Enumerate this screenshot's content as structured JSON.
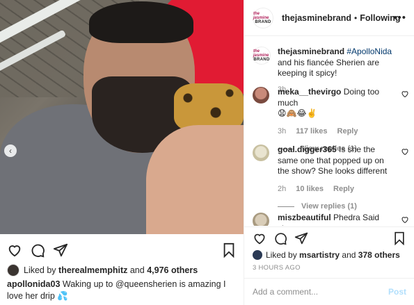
{
  "post": {
    "author": "thejasminebrand",
    "follow_state": "Following",
    "more_label": "•••",
    "logo_text_top": "the jasmine",
    "logo_text_bottom": "BRAND"
  },
  "caption_comment": {
    "author": "thejasminebrand",
    "hashtag": "#ApolloNida",
    "text": " and his fiancée Sherien are keeping it spicy!",
    "time": "3h"
  },
  "comments": [
    {
      "author": "meka__thevirgo",
      "text": "Doing too much",
      "emojis": "😧🙈😂✌️",
      "time": "3h",
      "likes": "117 likes",
      "reply": "Reply",
      "view_replies": "View replies (1)"
    },
    {
      "author": "goal.digger365",
      "text": "Is she the same one that popped up on the show? She looks different",
      "time": "2h",
      "likes": "10 likes",
      "reply": "Reply",
      "view_replies": "View replies (1)"
    },
    {
      "author": "miszbeautiful",
      "text": "Phedra Said she"
    }
  ],
  "left": {
    "liked_by_prefix": "Liked by ",
    "liked_by_user": "therealmemphitz",
    "liked_by_and": " and ",
    "liked_by_count": "4,976 others",
    "caption_author": "apollonida03",
    "caption_text": "Waking up to @queensherien is amazing I love her drip 💦",
    "carousel_prev": "‹"
  },
  "right": {
    "liked_by_prefix": "Liked by ",
    "liked_by_user": "msartistry",
    "liked_by_and": " and ",
    "liked_by_count": "378 others",
    "time_ago": "3 HOURS AGO",
    "comment_placeholder": "Add a comment...",
    "post_label": "Post"
  },
  "colors": {
    "text": "#262626",
    "muted": "#8e8e8e",
    "link": "#00376b",
    "post_disabled": "#b2dffc",
    "border": "#efefef"
  },
  "icons": [
    "heart-icon",
    "comment-icon",
    "share-icon",
    "bookmark-icon",
    "more-icon",
    "chevron-left-icon"
  ]
}
